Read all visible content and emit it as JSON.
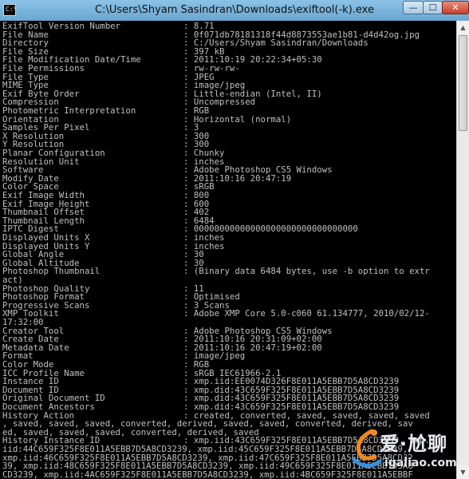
{
  "window": {
    "title": "C:\\Users\\Shyam Sasindran\\Downloads\\exiftool(-k).exe",
    "icon_text": "C:\\",
    "minimize_glyph": "—",
    "maximize_glyph": "☐",
    "close_glyph": "✕"
  },
  "scrollbar": {
    "up_glyph": "▲",
    "down_glyph": "▼"
  },
  "console": {
    "rows": [
      {
        "k": "ExifTool Version Number",
        "v": ": 8.71"
      },
      {
        "k": "File Name",
        "v": ": 0f071db78181318f44d8873553ae1b81-d4d42og.jpg"
      },
      {
        "k": "Directory",
        "v": ": C:/Users/Shyam Sasindran/Downloads"
      },
      {
        "k": "File Size",
        "v": ": 397 kB"
      },
      {
        "k": "File Modification Date/Time",
        "v": ": 2011:10:19 20:22:34+05:30"
      },
      {
        "k": "File Permissions",
        "v": ": rw-rw-rw-"
      },
      {
        "k": "File Type",
        "v": ": JPEG"
      },
      {
        "k": "MIME Type",
        "v": ": image/jpeg"
      },
      {
        "k": "Exif Byte Order",
        "v": ": Little-endian (Intel, II)"
      },
      {
        "k": "Compression",
        "v": ": Uncompressed"
      },
      {
        "k": "Photometric Interpretation",
        "v": ": RGB"
      },
      {
        "k": "Orientation",
        "v": ": Horizontal (normal)"
      },
      {
        "k": "Samples Per Pixel",
        "v": ": 3"
      },
      {
        "k": "X Resolution",
        "v": ": 300"
      },
      {
        "k": "Y Resolution",
        "v": ": 300"
      },
      {
        "k": "Planar Configuration",
        "v": ": Chunky"
      },
      {
        "k": "Resolution Unit",
        "v": ": inches"
      },
      {
        "k": "Software",
        "v": ": Adobe Photoshop CS5 Windows"
      },
      {
        "k": "Modify Date",
        "v": ": 2011:10:16 20:47:19"
      },
      {
        "k": "Color Space",
        "v": ": sRGB"
      },
      {
        "k": "Exif Image Width",
        "v": ": 800"
      },
      {
        "k": "Exif Image Height",
        "v": ": 600"
      },
      {
        "k": "Thumbnail Offset",
        "v": ": 402"
      },
      {
        "k": "Thumbnail Length",
        "v": ": 6484"
      },
      {
        "k": "IPTC Digest",
        "v": ": 00000000000000000000000000000000"
      },
      {
        "k": "Displayed Units X",
        "v": ": inches"
      },
      {
        "k": "Displayed Units Y",
        "v": ": inches"
      },
      {
        "k": "Global Angle",
        "v": ": 30"
      },
      {
        "k": "Global Altitude",
        "v": ": 30"
      },
      {
        "k": "Photoshop Thumbnail",
        "v": ": (Binary data 6484 bytes, use -b option to extr"
      },
      {
        "full": "act)"
      },
      {
        "k": "Photoshop Quality",
        "v": ": 11"
      },
      {
        "k": "Photoshop Format",
        "v": ": Optimised"
      },
      {
        "k": "Progressive Scans",
        "v": ": 3 Scans"
      },
      {
        "k": "XMP Toolkit",
        "v": ": Adobe XMP Core 5.0-c060 61.134777, 2010/02/12-"
      },
      {
        "full": "17:32:00"
      },
      {
        "k": "Creator Tool",
        "v": ": Adobe Photoshop CS5 Windows"
      },
      {
        "k": "Create Date",
        "v": ": 2011:10:16 20:31:09+02:00"
      },
      {
        "k": "Metadata Date",
        "v": ": 2011:10:16 20:47:19+02:00"
      },
      {
        "k": "Format",
        "v": ": image/jpeg"
      },
      {
        "k": "Color Mode",
        "v": ": RGB"
      },
      {
        "k": "ICC Profile Name",
        "v": ": sRGB IEC61966-2.1"
      },
      {
        "k": "Instance ID",
        "v": ": xmp.iid:EE0074D326F8E011A5EBB7D5A8CD3239"
      },
      {
        "k": "Document ID",
        "v": ": xmp.did:43C659F325F8E011A5EBB7D5A8CD3239"
      },
      {
        "k": "Original Document ID",
        "v": ": xmp.did:43C659F325F8E011A5EBB7D5A8CD3239"
      },
      {
        "k": "Document Ancestors",
        "v": ": xmp.did:43C659F325F8E011A5EBB7D5A8CD3239"
      },
      {
        "k": "History Action",
        "v": ": created, converted, saved, saved, saved, saved"
      },
      {
        "full": ", saved, saved, saved, converted, derived, saved, saved, converted, derived, sav"
      },
      {
        "full": "ed, saved, saved, saved, converted, derived, saved"
      },
      {
        "k": "History Instance ID",
        "v": ": xmp.iid:43C659F325F8E011A5EBB7D5A8CD3239, xmp."
      },
      {
        "full": "iid:44C659F325F8E011A5EBB7D5A8CD3239, xmp.iid:45C659F325F8E011A5EBB7D5A8CD3239,"
      },
      {
        "full": "xmp.iid:46C659F325F8E011A5EBB7D5A8CD3239, xmp.iid:47C659F325F8E011A5EBB7D5A8CD32"
      },
      {
        "full": "39, xmp.iid:48C659F325F8E011A5EBB7D5A8CD3239, xmp.iid:49C659F325F8E011A5EBB7D5A8"
      },
      {
        "full": "CD3239, xmp.iid:4AC659F325F8E011A5EBB7D5A8CD3239, xmp.iid:4BC659F325F8E011A5EBBF"
      }
    ]
  },
  "watermark": {
    "text": "爱·尬聊",
    "url": "igaliao.com"
  }
}
